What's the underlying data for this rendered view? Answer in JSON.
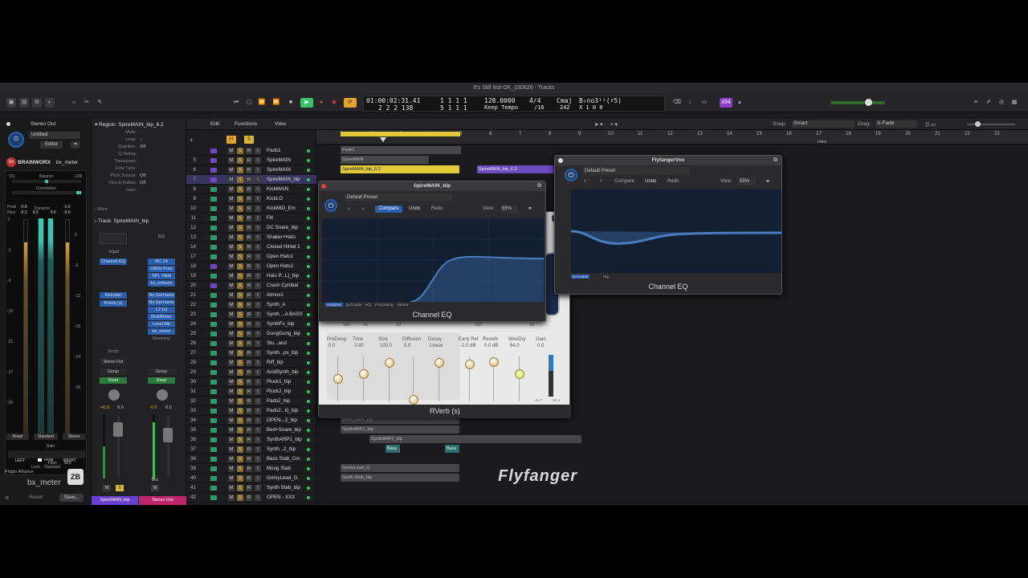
{
  "window": {
    "title": "It's Still Not OK_030626 - Tracks"
  },
  "transport": {
    "position": "01:00:02:31.41",
    "pos_bars": "1 1 1 1",
    "tempo": "128.0000",
    "signature": "4/4",
    "key": "Cmaj",
    "chord": "B♭no3¹¹(♯5)",
    "bars2": "2 2 2 138",
    "bars3": "5 1 1 1",
    "tempo_mode": "Keep Tempo",
    "division": "/16",
    "cpu": "242",
    "extra": "X 1 0 0",
    "count_in": "♯34"
  },
  "colors": {
    "accent_blue": "#2a5fb0",
    "record_red": "#e04040",
    "play_green": "#39c46a",
    "region_yellow": "#e2c93a",
    "region_purple": "#6f4bc2"
  },
  "inspector": {
    "stereo_out": "Stereo Out",
    "preset": "Untitled",
    "editor": "Editor",
    "brand": "BRAINWORX",
    "plugin": "bx_meter",
    "labels": {
      "balance": "Balance",
      "correlation": "Correlation",
      "dynamic": "Dynamic",
      "peak": "Peak",
      "rms": "Rms",
      "left": "LEFT",
      "right": "RIGHT",
      "float": "Float",
      "look": "Look",
      "standard": "Standard",
      "reset": "Reset",
      "stereo": "Stereo",
      "solo": "Solo",
      "filter": "Filter",
      "ms": "M/S",
      "alliance": "Plugin Alliance",
      "revert": "Revert",
      "save": "Save..."
    },
    "vals": {
      "bal_l": "12L",
      "bal_r": "12R",
      "peak_l": "-0.8",
      "peak_r": "-0.6",
      "rms_l": "-9.3",
      "rms_r": "-9.0",
      "dyn_l": "8.5",
      "dyn_r": "8.6"
    },
    "scale": [
      "3",
      "0",
      "-3",
      "-6",
      "-9",
      "-12",
      "-15",
      "-18",
      "-21",
      "-24",
      "-27",
      "-30",
      "-36"
    ],
    "region": {
      "label": "Region: SpireMAIN_bip_6.2",
      "rows": [
        [
          "Mute:",
          ""
        ],
        [
          "Loop:",
          "✓"
        ],
        [
          "Quantize:",
          "Off"
        ],
        [
          "Q-Swing:",
          ""
        ],
        [
          "Transpose:",
          ""
        ],
        [
          "Fine Tune:",
          ""
        ],
        [
          "Pitch Source:",
          "Off"
        ],
        [
          "Flex & Follow:",
          "Off"
        ],
        [
          "Gain:",
          ""
        ]
      ],
      "more": "More"
    },
    "track": {
      "label": "Track: SpireMAIN_bip"
    },
    "strip1": {
      "plugins": [
        "Input",
        "Channel EQ"
      ],
      "sends": [
        "Kickstart",
        "RVerb (s)"
      ],
      "sends_label": "Sends",
      "output": "Stereo Out",
      "group": "Group",
      "read": "Read",
      "vol": "-42.6",
      "pan": "0.0",
      "ms": "M",
      "s": "S",
      "name": "SpireMAIN_bip"
    },
    "strip2": {
      "eq": "EQ",
      "plugins": [
        "RC 24",
        "UADx Pure",
        "SPL Vitali",
        "bx_refinem",
        "Nx Germano",
        "Nx Germano",
        "L2 (s)",
        "MultiMeter",
        "Level Mtr",
        "bx_meter"
      ],
      "mastering": "Mastering",
      "group": "Group",
      "read": "Read",
      "vol": "-0.6",
      "pan": "0.0",
      "bnc": "Bnc",
      "m": "M",
      "name": "Stereo Out"
    }
  },
  "track_header": {
    "edit": "Edit",
    "functions": "Functions",
    "view": "View"
  },
  "tracks": [
    {
      "n": "",
      "name": "Pads1",
      "c": "#6f4bc2"
    },
    {
      "n": "5",
      "name": "SpireMAIN",
      "c": "#6f4bc2"
    },
    {
      "n": "6",
      "name": "SpireMAIN",
      "c": "#6f4bc2"
    },
    {
      "n": "7",
      "name": "SpireMAIN_bip",
      "c": "#6f4bc2",
      "sel": true
    },
    {
      "n": "8",
      "name": "KickMAIN",
      "c": "#2d9e6b"
    },
    {
      "n": "9",
      "name": "KickLO",
      "c": "#2d9e6b"
    },
    {
      "n": "10",
      "name": "KickMID_Em",
      "c": "#2d9e6b"
    },
    {
      "n": "11",
      "name": "Fill",
      "c": "#2d9e6b"
    },
    {
      "n": "12",
      "name": "DC Snare_bip",
      "c": "#2d9e6b"
    },
    {
      "n": "13",
      "name": "Shaker+Hats",
      "c": "#2d9e6b"
    },
    {
      "n": "14",
      "name": "Closed HiHat 1",
      "c": "#2d9e6b"
    },
    {
      "n": "17",
      "name": "Open Hats1",
      "c": "#2d9e6b"
    },
    {
      "n": "18",
      "name": "Open Hats2",
      "c": "#6f4bc2"
    },
    {
      "n": "19",
      "name": "Hats P...L)_bip",
      "c": "#2d9e6b"
    },
    {
      "n": "20",
      "name": "Crash Cymbal",
      "c": "#6f4bc2"
    },
    {
      "n": "21",
      "name": "Atmos1",
      "c": "#2d9e6b"
    },
    {
      "n": "22",
      "name": "Synth_A",
      "c": "#2d9e6b"
    },
    {
      "n": "23",
      "name": "Synth ...A BASS",
      "c": "#2d9e6b"
    },
    {
      "n": "24",
      "name": "SynthFx_bip",
      "c": "#2d9e6b"
    },
    {
      "n": "25",
      "name": "GungGung_bip",
      "c": "#2d9e6b"
    },
    {
      "n": "26",
      "name": "Stu...and",
      "c": "#2d9e6b"
    },
    {
      "n": "27",
      "name": "Synth...ps_bip",
      "c": "#2d9e6b"
    },
    {
      "n": "28",
      "name": "Riff_bip",
      "c": "#2d9e6b"
    },
    {
      "n": "29",
      "name": "AcidSynth_bip",
      "c": "#2d9e6b"
    },
    {
      "n": "30",
      "name": "Pluck1_bip",
      "c": "#2d9e6b"
    },
    {
      "n": "31",
      "name": "Pluck2_bip",
      "c": "#2d9e6b"
    },
    {
      "n": "32",
      "name": "Pads2_bip",
      "c": "#2d9e6b"
    },
    {
      "n": "33",
      "name": "Pads2...il)_bip",
      "c": "#2d9e6b"
    },
    {
      "n": "34",
      "name": "OPEN...2_bip",
      "c": "#2d9e6b"
    },
    {
      "n": "35",
      "name": "Bed+Snare_bip",
      "c": "#2d9e6b"
    },
    {
      "n": "36",
      "name": "SynthARP1_bip",
      "c": "#2d9e6b"
    },
    {
      "n": "37",
      "name": "Synth...2_bip",
      "c": "#2d9e6b"
    },
    {
      "n": "38",
      "name": "Bass Stab_Cm",
      "c": "#2d9e6b"
    },
    {
      "n": "39",
      "name": "Moog Stab",
      "c": "#2d9e6b"
    },
    {
      "n": "40",
      "name": "GrimyLead_G",
      "c": "#2d9e6b"
    },
    {
      "n": "41",
      "name": "Synth Stab_bip",
      "c": "#2d9e6b"
    },
    {
      "n": "42",
      "name": "OPEN - XXX",
      "c": "#2d9e6b"
    }
  ],
  "arrange": {
    "snap_label": "Snap:",
    "snap": "Smart",
    "drag_label": "Drag:",
    "drag": "X-Fade",
    "ruler": [
      "1",
      "2",
      "3",
      "4",
      "5",
      "6",
      "7",
      "8",
      "9",
      "10",
      "11",
      "12",
      "13",
      "14",
      "15",
      "16",
      "17",
      "18",
      "19",
      "20",
      "21",
      "22",
      "23"
    ],
    "marker": "Intro",
    "regions": [
      "Pads1",
      "SpireMAIN",
      "SpireMAIN_bip_6.2",
      "SpireMAIN_bip_6.3",
      "Bed+Snare_bip",
      "SynthARP1_bip",
      "SynthARP2_bip",
      "Bass",
      "Bass",
      "GrimyLead_G",
      "Synth Stab_bip"
    ],
    "watermark": "Flyfanger"
  },
  "eq_main": {
    "title": "SpireMAIN_bip",
    "preset": "Default Preset",
    "compare": "Compare",
    "undo": "Undo",
    "redo": "Redo",
    "view_label": "View:",
    "view": "55%",
    "name": "Channel EQ",
    "analyzer": "Analyzer",
    "q_couple": "Q-Couple",
    "hq": "HQ",
    "processing": "Processing",
    "stereo": "Stereo"
  },
  "eq_right": {
    "title": "FlyfangerVox",
    "preset": "Default Preset",
    "compare": "Compare",
    "undo": "Undo",
    "redo": "Redo",
    "view_label": "View:",
    "view": "55%",
    "name": "Channel EQ",
    "q_couple": "Q-Couple",
    "hq": "HQ"
  },
  "reverb": {
    "name": "RVerb (s)",
    "freq": [
      "100",
      "1K",
      "20",
      "100",
      "1K"
    ],
    "params": [
      {
        "l": "PreDelay",
        "v": "0.0"
      },
      {
        "l": "Time",
        "v": "2.40"
      },
      {
        "l": "Size",
        "v": "100.0"
      },
      {
        "l": "Diffusion",
        "v": "0.0"
      },
      {
        "l": "Decay",
        "v": "Linear"
      },
      {
        "l": "Early Ref",
        "v": "-2.0 dB"
      },
      {
        "l": "Reverb",
        "v": "0.0 dB"
      },
      {
        "l": "Wet/Dry",
        "v": "64.0"
      },
      {
        "l": "Gain",
        "v": "0.0"
      }
    ],
    "meter_l": "-61.7",
    "meter_r": "-59.4"
  }
}
